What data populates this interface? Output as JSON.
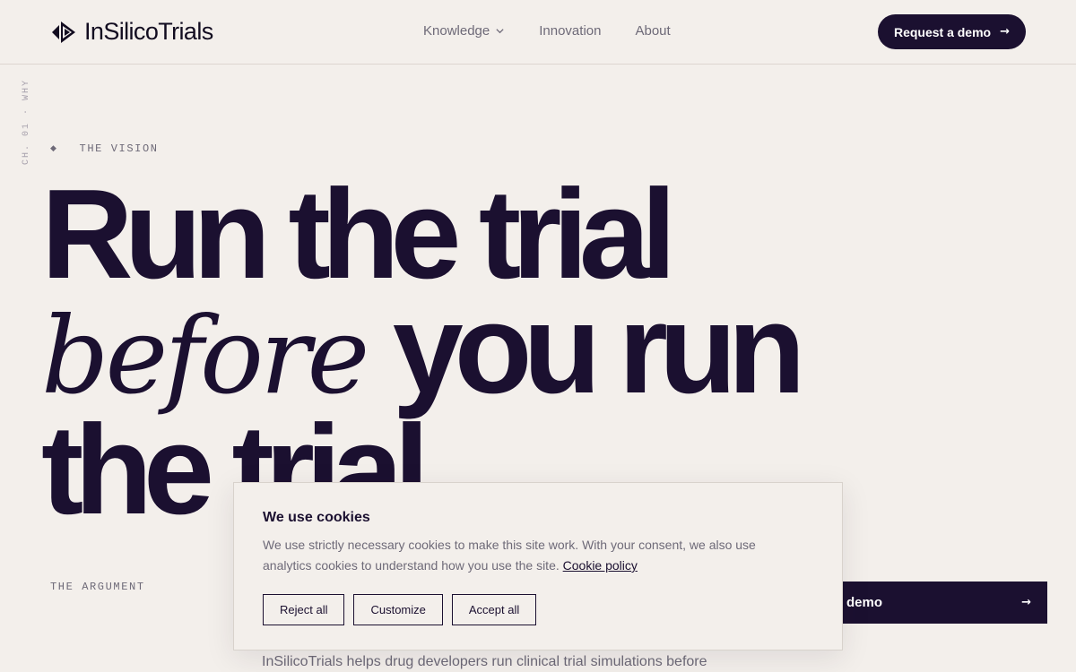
{
  "brand": {
    "name": "InSilicoTrials"
  },
  "nav": {
    "items": [
      {
        "label": "Knowledge",
        "has_dropdown": true
      },
      {
        "label": "Innovation"
      },
      {
        "label": "About"
      }
    ],
    "cta_label": "Request a demo",
    "cta_arrow": "→"
  },
  "chapter_label": "CH. 01 · WHY",
  "eyebrow": {
    "marker": "◆",
    "label": "THE VISION"
  },
  "headline": {
    "line1": "Run the trial",
    "line2_serif": "before",
    "line2_rest": " you run",
    "line3": "the trial"
  },
  "argument_label": "THE ARGUMENT",
  "demo_bar": {
    "label": "demo",
    "arrow": "→"
  },
  "body_text": "InSilicoTrials helps drug developers run clinical trial simulations before",
  "cookie": {
    "title": "We use cookies",
    "text": "We use strictly necessary cookies to make this site work. With your consent, we also use analytics cookies to understand how you use the site.",
    "link": "Cookie policy",
    "buttons": {
      "reject": "Reject all",
      "customize": "Customize",
      "accept": "Accept all"
    }
  },
  "colors": {
    "background": "#f3efeb",
    "ink": "#1b1030",
    "muted": "#6e6a78"
  }
}
